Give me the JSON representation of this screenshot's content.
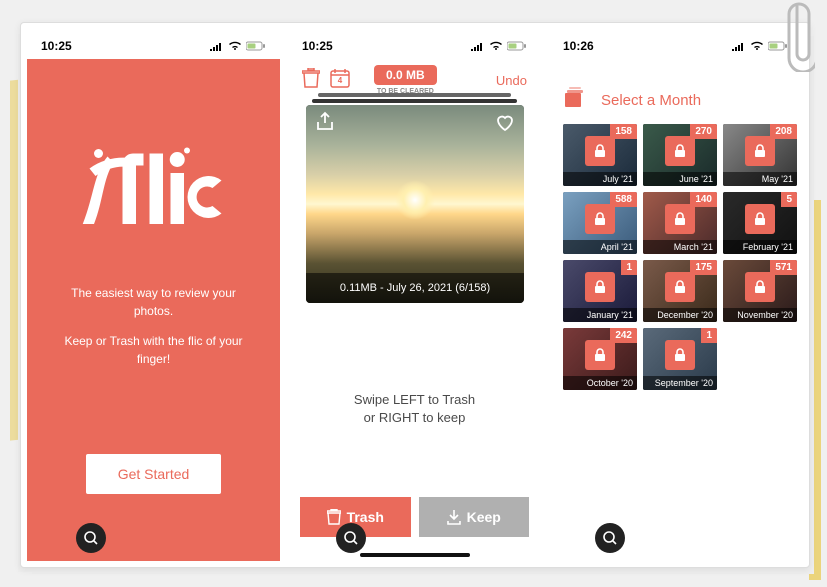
{
  "colors": {
    "accent": "#ea6a5b",
    "gray": "#b0b0b0"
  },
  "screen1": {
    "time": "10:25",
    "logo_text": "flic",
    "tagline1": "The easiest way to review your photos.",
    "tagline2": "Keep or Trash with the flic of your finger!",
    "get_started": "Get Started"
  },
  "screen2": {
    "time": "10:25",
    "calendar_day": "4",
    "mb_value": "0.0 MB",
    "mb_sub": "TO BE CLEARED",
    "undo": "Undo",
    "card_meta": "0.11MB - July 26, 2021 (6/158)",
    "hint_line1": "Swipe LEFT to Trash",
    "hint_line2": "or RIGHT to keep",
    "trash_label": "Trash",
    "keep_label": "Keep"
  },
  "screen3": {
    "time": "10:26",
    "select_month": "Select a Month",
    "months": [
      {
        "label": "July '21",
        "count": "158",
        "bg": "linear-gradient(135deg,#4a5a6a,#1a2a3a)"
      },
      {
        "label": "June '21",
        "count": "270",
        "bg": "linear-gradient(135deg,#3a5a4a,#1a2a2a)"
      },
      {
        "label": "May '21",
        "count": "208",
        "bg": "linear-gradient(135deg,#888,#333)"
      },
      {
        "label": "April '21",
        "count": "588",
        "bg": "linear-gradient(135deg,#7aa0c0,#3a5a7a)"
      },
      {
        "label": "March '21",
        "count": "140",
        "bg": "linear-gradient(135deg,#a05a4a,#4a2a2a)"
      },
      {
        "label": "February '21",
        "count": "5",
        "bg": "linear-gradient(135deg,#2a2a2a,#111)"
      },
      {
        "label": "January '21",
        "count": "1",
        "bg": "linear-gradient(135deg,#4a4a6a,#1a1a3a)"
      },
      {
        "label": "December '20",
        "count": "175",
        "bg": "linear-gradient(135deg,#7a5a4a,#3a2a1a)"
      },
      {
        "label": "November '20",
        "count": "571",
        "bg": "linear-gradient(135deg,#6a4a3a,#2a1a1a)"
      },
      {
        "label": "October '20",
        "count": "242",
        "bg": "linear-gradient(135deg,#7a3a3a,#3a1a1a)"
      },
      {
        "label": "September '20",
        "count": "1",
        "bg": "linear-gradient(135deg,#5a6a7a,#2a3a4a)"
      }
    ]
  }
}
